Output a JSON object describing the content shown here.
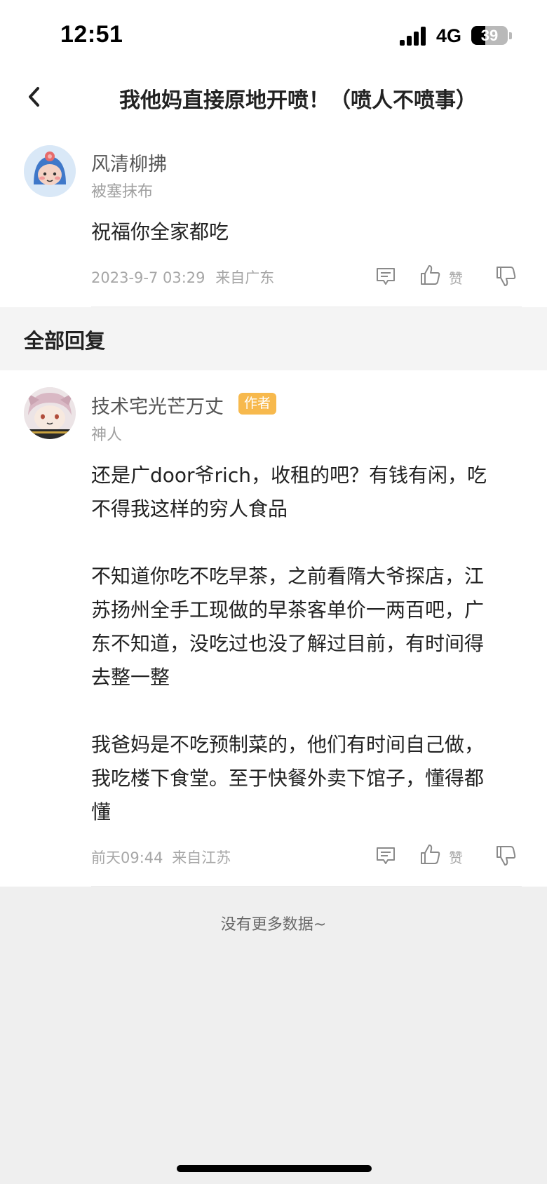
{
  "status_bar": {
    "time": "12:51",
    "network": "4G",
    "battery_percent": "39",
    "battery_level": 0.39
  },
  "header": {
    "title": "我他妈直接原地开喷！（喷人不喷事）",
    "back_icon": "chevron-left-icon"
  },
  "main_comment": {
    "username": "风清柳拂",
    "user_tag": "被塞抹布",
    "content": "祝福你全家都吃",
    "date": "2023-9-7 03:29",
    "location": "来自广东",
    "like_label": "赞",
    "icons": [
      "reply-icon",
      "thumbs-up-icon",
      "thumbs-down-icon"
    ]
  },
  "replies_section": {
    "title": "全部回复"
  },
  "reply": {
    "username": "技术宅光芒万丈",
    "badge": "作者",
    "badge_color": "#f7b94d",
    "user_tag": "神人",
    "lines": [
      "还是广door爷rich，收租的吧？有钱有闲，吃",
      "不得我这样的穷人食品",
      "",
      "不知道你吃不吃早茶，之前看隋大爷探店，江",
      "苏扬州全手工现做的早茶客单价一两百吧，广",
      "东不知道，没吃过也没了解过目前，有时间得",
      "去整一整",
      "",
      "我爸妈是不吃预制菜的，他们有时间自己做，",
      "我吃楼下食堂。至于快餐外卖下馆子，懂得都",
      "懂"
    ],
    "date": "前天09:44",
    "location": "来自江苏",
    "like_label": "赞"
  },
  "footer": {
    "end_text": "没有更多数据~"
  }
}
